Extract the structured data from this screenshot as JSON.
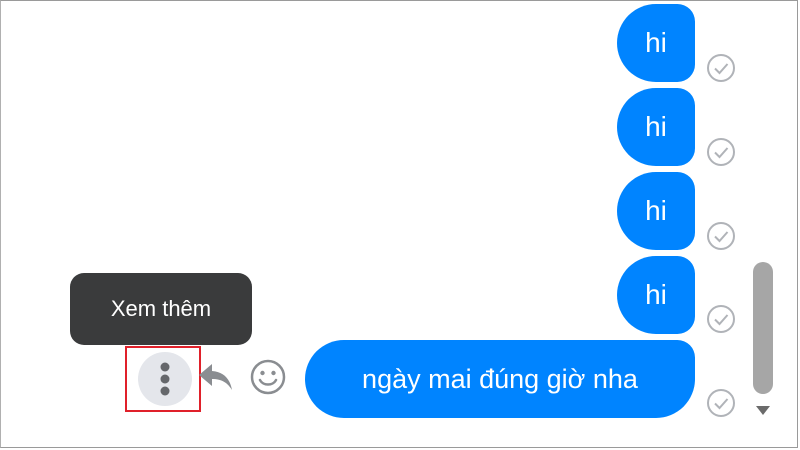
{
  "messages": [
    {
      "text": "hi",
      "status_icon": "check-circle-icon"
    },
    {
      "text": "hi",
      "status_icon": "check-circle-icon"
    },
    {
      "text": "hi",
      "status_icon": "check-circle-icon"
    },
    {
      "text": "hi",
      "status_icon": "check-circle-icon"
    },
    {
      "text": "ngày mai đúng giờ nha",
      "status_icon": "check-circle-icon"
    }
  ],
  "tooltip": {
    "text": "Xem thêm"
  },
  "actions": {
    "more_icon": "vertical-dots-icon",
    "reply_icon": "reply-arrow-icon",
    "react_icon": "smiley-icon"
  },
  "colors": {
    "bubble": "#0084ff",
    "tooltip_bg": "#3a3b3c",
    "highlight": "#e0202a"
  }
}
